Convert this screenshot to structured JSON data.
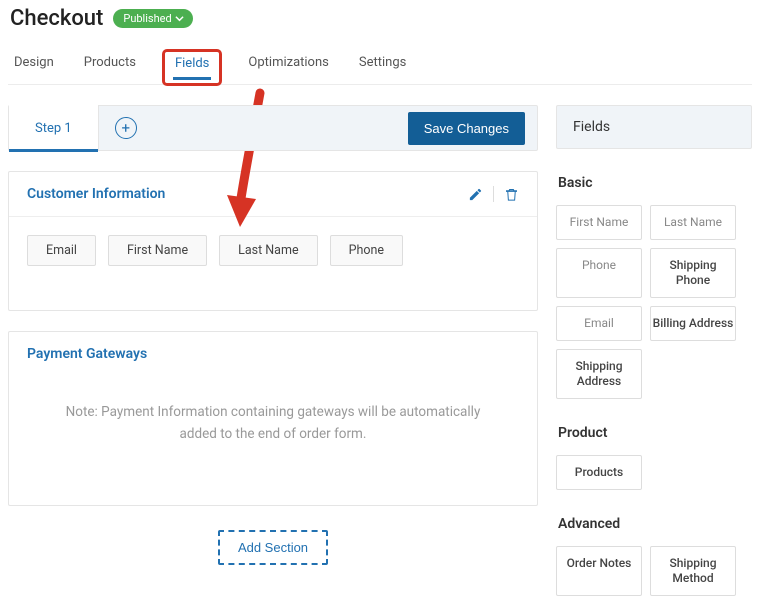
{
  "header": {
    "title": "Checkout",
    "status": "Published"
  },
  "tabs": [
    "Design",
    "Products",
    "Fields",
    "Optimizations",
    "Settings"
  ],
  "active_tab": "Fields",
  "steps": {
    "current": "Step 1",
    "save_label": "Save Changes"
  },
  "sections": {
    "customer": {
      "title": "Customer Information",
      "fields": [
        "Email",
        "First Name",
        "Last Name",
        "Phone"
      ]
    },
    "gateways": {
      "title": "Payment Gateways",
      "note": "Note: Payment Information containing gateways will be automatically added to the end of order form."
    },
    "add_label": "Add Section"
  },
  "sidebar": {
    "header": "Fields",
    "groups": {
      "basic": {
        "title": "Basic",
        "chips": [
          "First Name",
          "Last Name",
          "Phone",
          "Shipping Phone",
          "Email",
          "Billing Address",
          "Shipping Address"
        ]
      },
      "product": {
        "title": "Product",
        "chips": [
          "Products"
        ]
      },
      "advanced": {
        "title": "Advanced",
        "chips": [
          "Order Notes",
          "Shipping Method"
        ]
      }
    }
  }
}
